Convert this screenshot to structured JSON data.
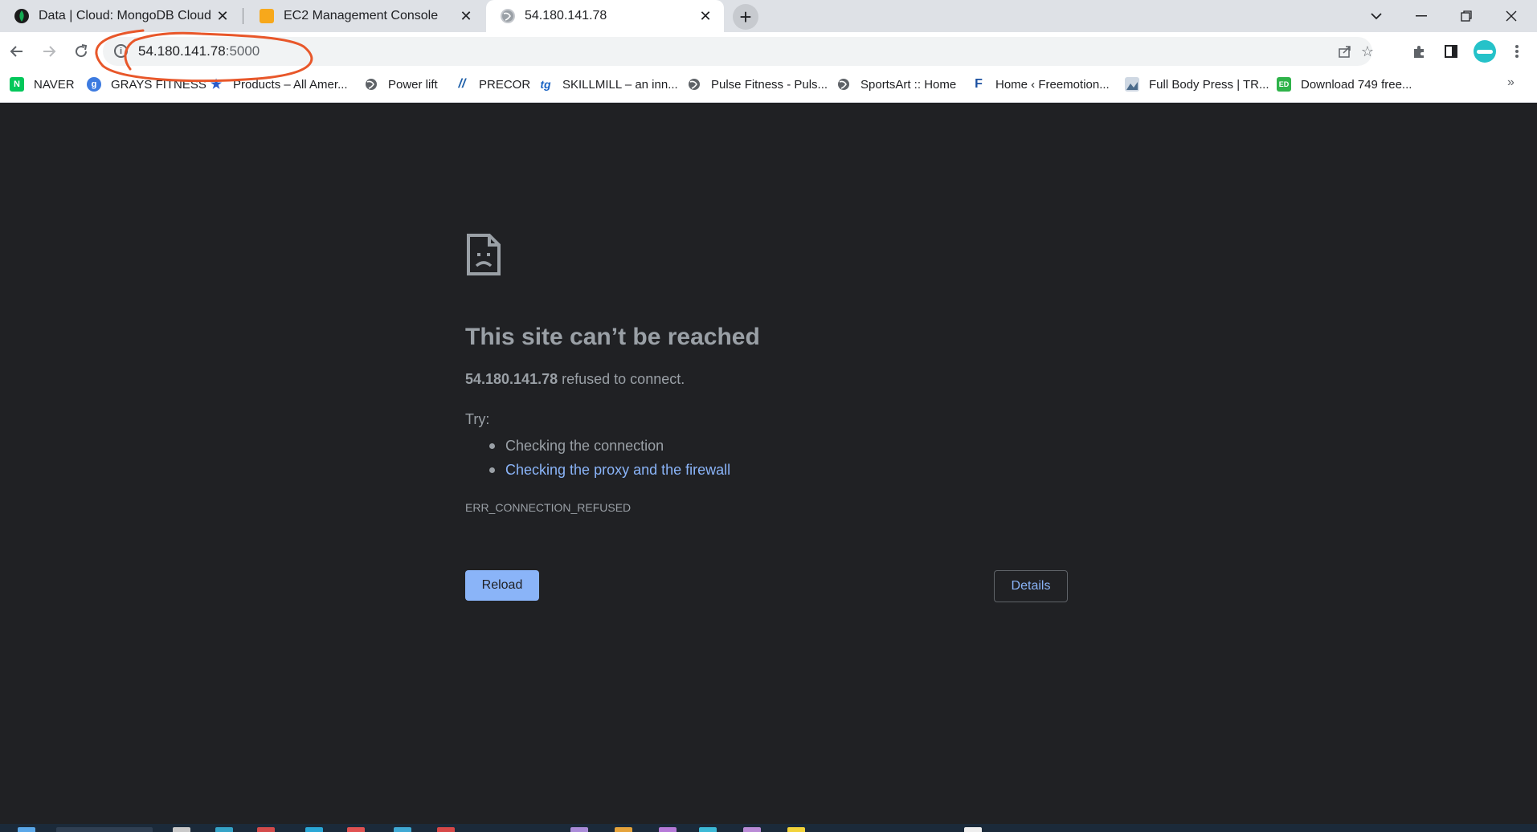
{
  "browser": {
    "tabs": [
      {
        "title": "Data | Cloud: MongoDB Cloud",
        "active": false,
        "icon": "mongodb-leaf-icon"
      },
      {
        "title": "EC2 Management Console",
        "active": false,
        "icon": "aws-cube-icon"
      },
      {
        "title": "54.180.141.78",
        "active": true,
        "icon": "globe-icon"
      }
    ],
    "address": {
      "host": "54.180.141.78",
      "port": ":5000"
    },
    "bookmarks": [
      {
        "label": "NAVER",
        "icon": "naver-icon"
      },
      {
        "label": "GRAYS FITNESS",
        "icon": "grays-icon"
      },
      {
        "label": "Products – All Amer...",
        "icon": "star-icon"
      },
      {
        "label": "Power lift",
        "icon": "globe-icon"
      },
      {
        "label": "PRECOR",
        "icon": "precor-icon"
      },
      {
        "label": "SKILLMILL – an inn...",
        "icon": "technogym-icon"
      },
      {
        "label": "Pulse Fitness - Puls...",
        "icon": "globe-icon"
      },
      {
        "label": "SportsArt :: Home",
        "icon": "globe-icon"
      },
      {
        "label": "Home ‹ Freemotion...",
        "icon": "freemotion-icon"
      },
      {
        "label": "Full Body Press | TR...",
        "icon": "image-icon"
      },
      {
        "label": "Download 749 free...",
        "icon": "ed-icon"
      }
    ]
  },
  "error_page": {
    "title": "This site can’t be reached",
    "host": "54.180.141.78",
    "message": " refused to connect.",
    "try_label": "Try:",
    "suggestions": [
      "Checking the connection",
      "Checking the proxy and the firewall"
    ],
    "error_code": "ERR_CONNECTION_REFUSED",
    "reload_label": "Reload",
    "details_label": "Details"
  },
  "colors": {
    "page_bg": "#202124",
    "text": "#9aa0a6",
    "link": "#8ab4f8",
    "annotation": "#e8572a"
  }
}
